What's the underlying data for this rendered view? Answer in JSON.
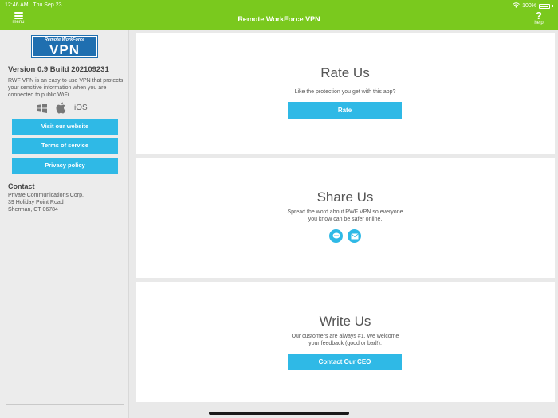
{
  "status_bar": {
    "time": "12:46 AM",
    "date": "Thu Sep 23",
    "battery": "100%"
  },
  "header": {
    "title": "Remote WorkForce VPN",
    "menu_label": "menu",
    "help_label": "help",
    "help_symbol": "?"
  },
  "sidebar": {
    "logo_top": "Remote WorkForce",
    "logo_main": "VPN",
    "version": "Version 0.9 Build 202109231",
    "description": "RWF VPN is an easy-to-use VPN that protects your sensitive information when you are connected to public WiFi.",
    "platforms": [
      "windows-icon",
      "apple-icon",
      "iOS"
    ],
    "ios_label": "iOS",
    "buttons": {
      "website": "Visit our website",
      "terms": "Terms of service",
      "privacy": "Privacy policy"
    },
    "contact": {
      "title": "Contact",
      "line1": "Private Communications Corp.",
      "line2": "39 Holiday Point Road",
      "line3": "Sherman, CT 06784"
    }
  },
  "cards": {
    "rate": {
      "title": "Rate Us",
      "text": "Like the protection you get with this app?",
      "button": "Rate"
    },
    "share": {
      "title": "Share Us",
      "text": "Spread the word about RWF VPN so everyone you know can be safer online.",
      "icons": [
        "message-icon",
        "mail-icon"
      ]
    },
    "write": {
      "title": "Write Us",
      "text": "Our customers are always #1. We welcome your feedback (good or bad!).",
      "button": "Contact Our CEO"
    }
  },
  "colors": {
    "header_green": "#7ac91e",
    "button_blue": "#2fb9e6",
    "logo_blue": "#1f6fb0"
  }
}
